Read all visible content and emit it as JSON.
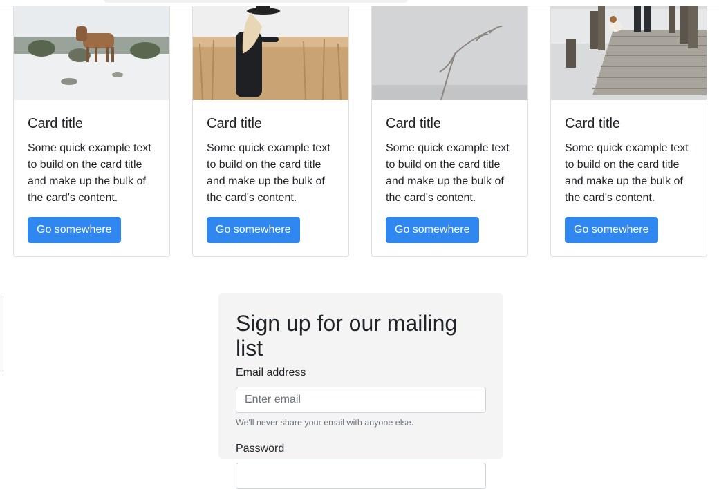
{
  "cards": [
    {
      "image": "horse-in-snow-image",
      "title": "Card title",
      "text": "Some quick example text to build on the card title and make up the bulk of the card's content.",
      "button": "Go somewhere"
    },
    {
      "image": "woman-in-field-image",
      "title": "Card title",
      "text": "Some quick example text to build on the card title and make up the bulk of the card's content.",
      "button": "Go somewhere"
    },
    {
      "image": "bare-tree-image",
      "title": "Card title",
      "text": "Some quick example text to build on the card title and make up the bulk of the card's content.",
      "button": "Go somewhere"
    },
    {
      "image": "wooden-pier-image",
      "title": "Card title",
      "text": "Some quick example text to build on the card title and make up the bulk of the card's content.",
      "button": "Go somewhere"
    }
  ],
  "signup": {
    "title": "Sign up for our mailing list",
    "email_label": "Email address",
    "email_placeholder": "Enter email",
    "email_help": "We'll never share your email with anyone else.",
    "password_label": "Password"
  },
  "colors": {
    "primary_button": "#2f87ef",
    "form_background": "#f4f4f4"
  }
}
